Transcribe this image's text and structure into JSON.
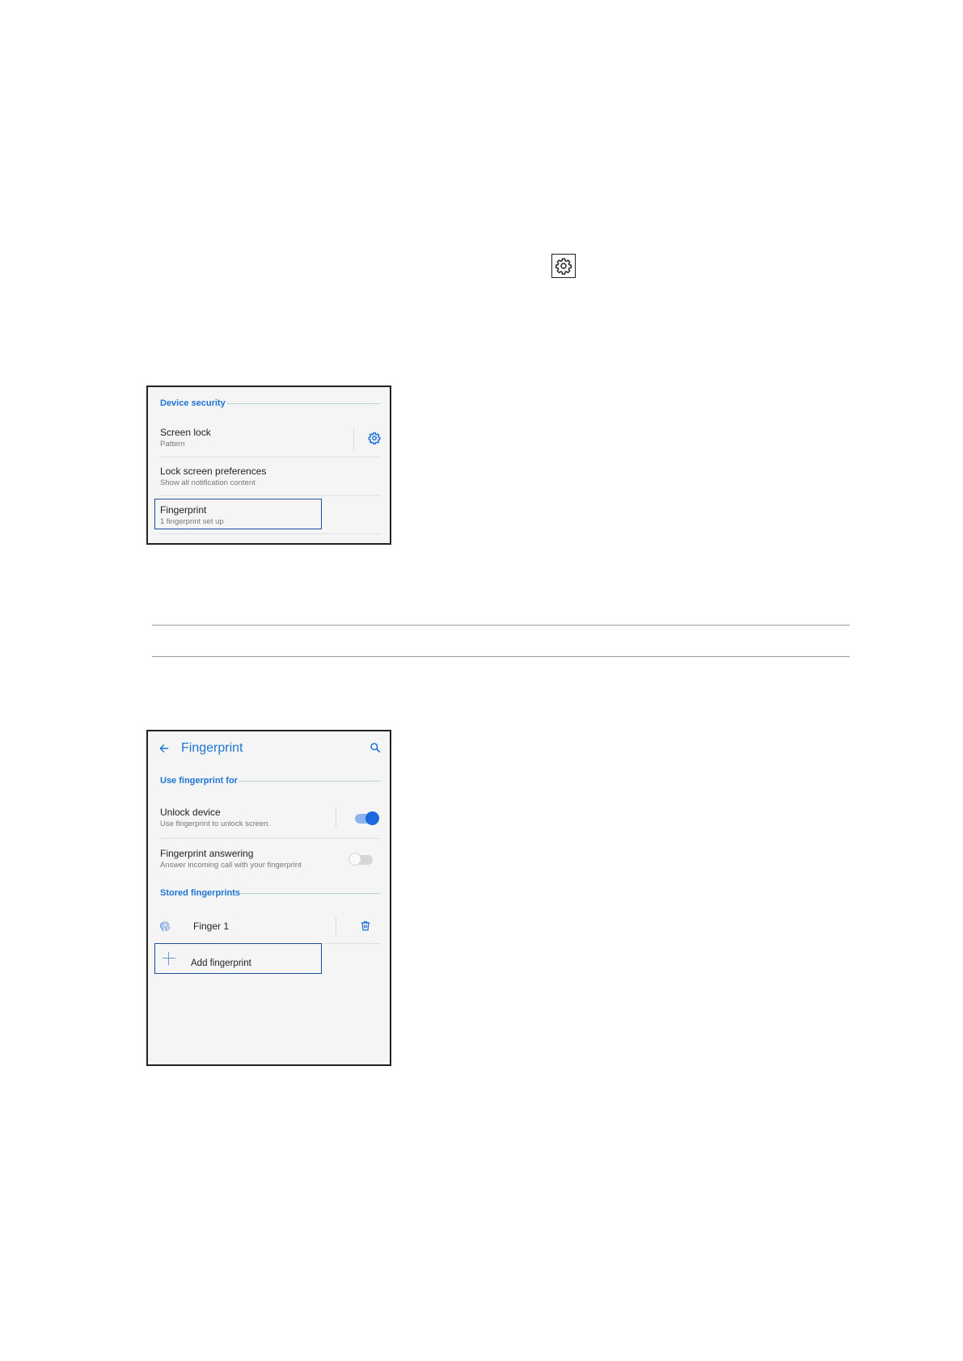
{
  "settings_icon": {
    "name": "gear-icon"
  },
  "screen1": {
    "section_header": "Device security",
    "items": [
      {
        "title": "Screen lock",
        "subtitle": "Pattern"
      },
      {
        "title": "Lock screen preferences",
        "subtitle": "Show all notification content"
      },
      {
        "title": "Fingerprint",
        "subtitle": "1 fingerprint set up"
      }
    ],
    "colors": {
      "accent": "#1e74d4",
      "highlight": "#1c4fa3"
    }
  },
  "screen2": {
    "app_bar_title": "Fingerprint",
    "section_use": "Use fingerprint for",
    "unlock": {
      "title": "Unlock device",
      "subtitle": "Use fingerprint to unlock screen.",
      "toggle_on": true
    },
    "answering": {
      "title": "Fingerprint answering",
      "subtitle": "Answer incoming call with your fingerprint",
      "toggle_on": false
    },
    "section_stored": "Stored fingerprints",
    "finger": {
      "label": "Finger 1"
    },
    "add": {
      "label": "Add fingerprint"
    }
  }
}
